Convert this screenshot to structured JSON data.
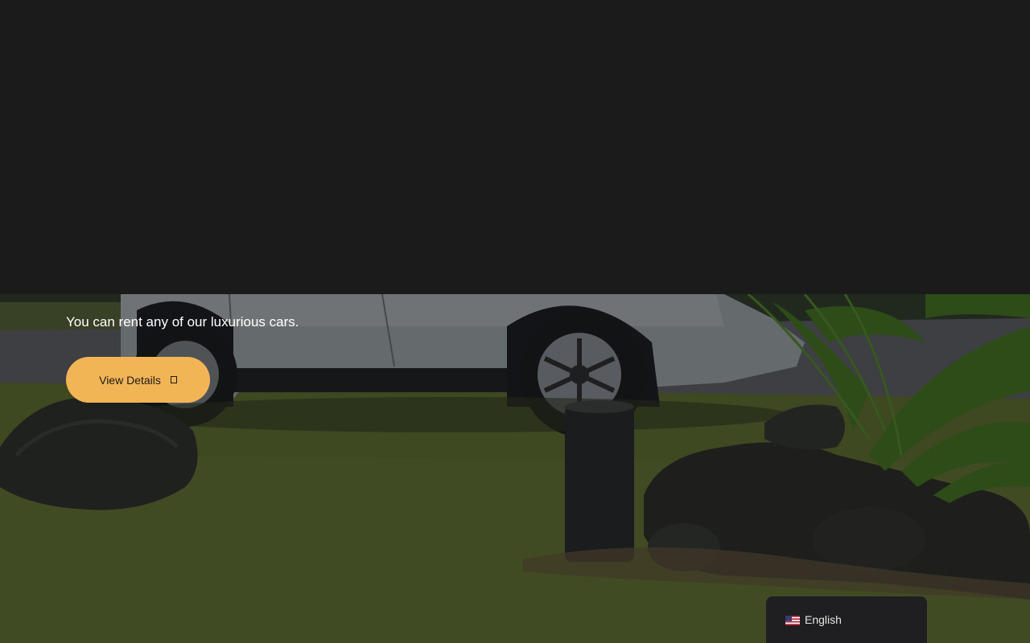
{
  "hero": {
    "tagline": "You can rent any of our luxurious cars.",
    "cta_label": "View Details",
    "cta_icon": "arrow-right-icon"
  },
  "language_switcher": {
    "selected": "English",
    "flag_icon": "us-flag-icon"
  },
  "colors": {
    "background": "#1b1b1b",
    "accent": "#f2b556",
    "lang_panel": "#1f1f21"
  }
}
